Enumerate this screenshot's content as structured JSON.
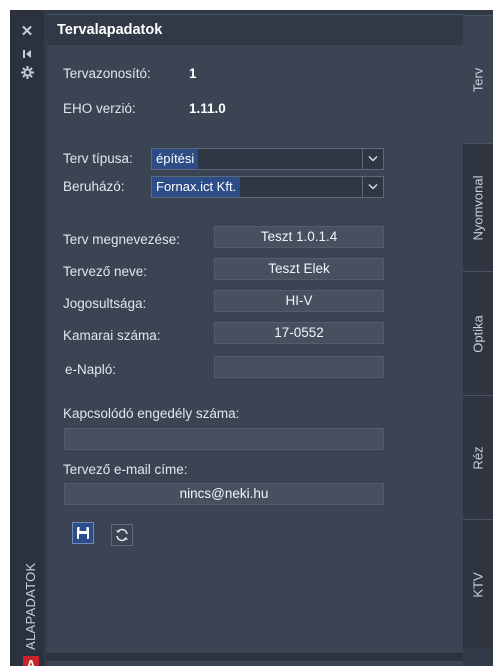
{
  "panel": {
    "title": "Tervalapadatok",
    "vertical_label": "ALAPADATOK"
  },
  "icons": {
    "close": "close-icon",
    "pin": "pin-icon",
    "settings": "gear-icon",
    "app_logo": "autocad-logo-icon"
  },
  "app_logo_letter": "A",
  "fields": {
    "tervazonosito": {
      "label": "Tervazonosító:",
      "value": "1"
    },
    "eho_verzio": {
      "label": "EHO verzió:",
      "value": "1.11.0"
    },
    "terv_tipusa": {
      "label": "Terv típusa:",
      "value": "építési"
    },
    "beruhazo": {
      "label": "Beruházó:",
      "value": "Fornax.ict Kft."
    },
    "terv_megnevezese": {
      "label": "Terv megnevezése:",
      "value": "Teszt 1.0.1.4"
    },
    "tervezo_neve": {
      "label": "Tervező neve:",
      "value": "Teszt Elek"
    },
    "jogosultsaga": {
      "label": "Jogosultsága:",
      "value": "HI-V"
    },
    "kamarai_szama": {
      "label": "Kamarai száma:",
      "value": "17-0552"
    },
    "e_naplo": {
      "label": "e-Napló:",
      "value": ""
    },
    "engedely": {
      "label": "Kapcsolódó engedély száma:",
      "value": ""
    },
    "email": {
      "label": "Tervező e-mail címe:",
      "value": "nincs@neki.hu"
    }
  },
  "buttons": {
    "save_icon": "save-icon",
    "refresh_icon": "refresh-icon"
  },
  "tabs": [
    {
      "label": "Terv",
      "active": true
    },
    {
      "label": "Nyomvonal",
      "active": false
    },
    {
      "label": "Optika",
      "active": false
    },
    {
      "label": "Réz",
      "active": false
    },
    {
      "label": "KTV",
      "active": false
    }
  ],
  "colors": {
    "panel_bg": "#3b4453",
    "accent_blue": "#2d4d86",
    "logo_red": "#c8232c"
  }
}
